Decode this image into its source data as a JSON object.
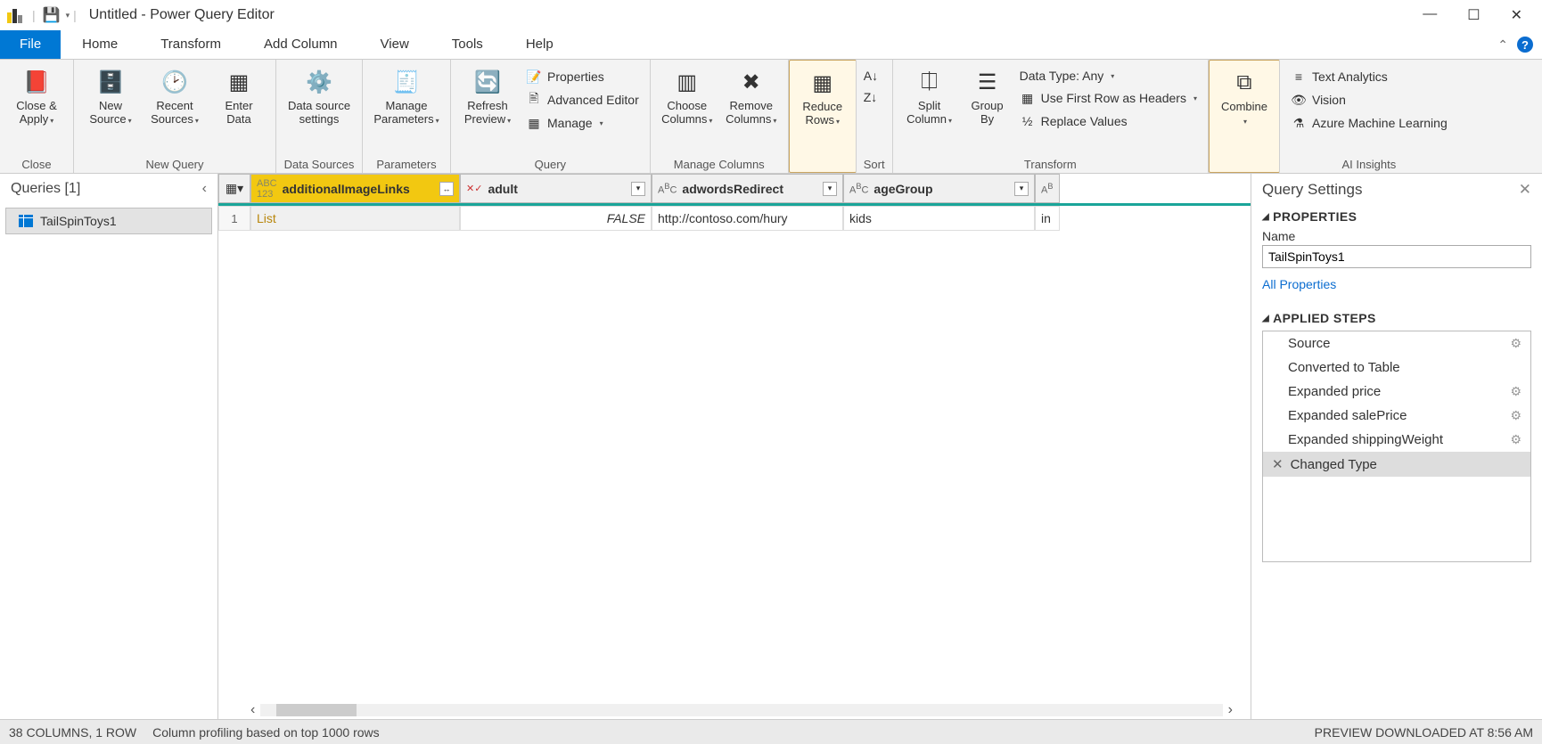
{
  "title": "Untitled - Power Query Editor",
  "tabs": {
    "file": "File",
    "home": "Home",
    "transform": "Transform",
    "addcol": "Add Column",
    "view": "View",
    "tools": "Tools",
    "help": "Help"
  },
  "ribbon": {
    "close": {
      "closeApply": "Close &\nApply",
      "group": "Close"
    },
    "newquery": {
      "newSource": "New\nSource",
      "recentSources": "Recent\nSources",
      "enterData": "Enter\nData",
      "group": "New Query"
    },
    "datasources": {
      "dss": "Data source\nsettings",
      "group": "Data Sources"
    },
    "parameters": {
      "manage": "Manage\nParameters",
      "group": "Parameters"
    },
    "query": {
      "refresh": "Refresh\nPreview",
      "properties": "Properties",
      "advEditor": "Advanced Editor",
      "manage": "Manage",
      "group": "Query"
    },
    "managecols": {
      "choose": "Choose\nColumns",
      "remove": "Remove\nColumns",
      "group": "Manage Columns"
    },
    "reduceRows": {
      "label": "Reduce\nRows"
    },
    "sort": {
      "group": "Sort"
    },
    "split": {
      "split": "Split\nColumn",
      "groupby": "Group\nBy"
    },
    "transform": {
      "dtype": "Data Type: Any",
      "firstRow": "Use First Row as Headers",
      "replace": "Replace Values",
      "group": "Transform"
    },
    "combine": {
      "label": "Combine"
    },
    "ai": {
      "text": "Text Analytics",
      "vision": "Vision",
      "aml": "Azure Machine Learning",
      "group": "AI Insights"
    }
  },
  "queries": {
    "title": "Queries [1]",
    "item": "TailSpinToys1"
  },
  "grid": {
    "cols": {
      "c1": "additionalImageLinks",
      "c2": "adult",
      "c3": "adwordsRedirect",
      "c4": "ageGroup"
    },
    "row1": {
      "num": "1",
      "c1": "List",
      "c2": "FALSE",
      "c3": "http://contoso.com/hury",
      "c4": "kids",
      "c5": "in"
    }
  },
  "settings": {
    "title": "Query Settings",
    "properties": "PROPERTIES",
    "name": "Name",
    "nameVal": "TailSpinToys1",
    "allProps": "All Properties",
    "applied": "APPLIED STEPS",
    "steps": [
      "Source",
      "Converted to Table",
      "Expanded price",
      "Expanded salePrice",
      "Expanded shippingWeight",
      "Changed Type"
    ]
  },
  "status": {
    "left": "38 COLUMNS, 1 ROW",
    "mid": "Column profiling based on top 1000 rows",
    "right": "PREVIEW DOWNLOADED AT 8:56 AM"
  }
}
